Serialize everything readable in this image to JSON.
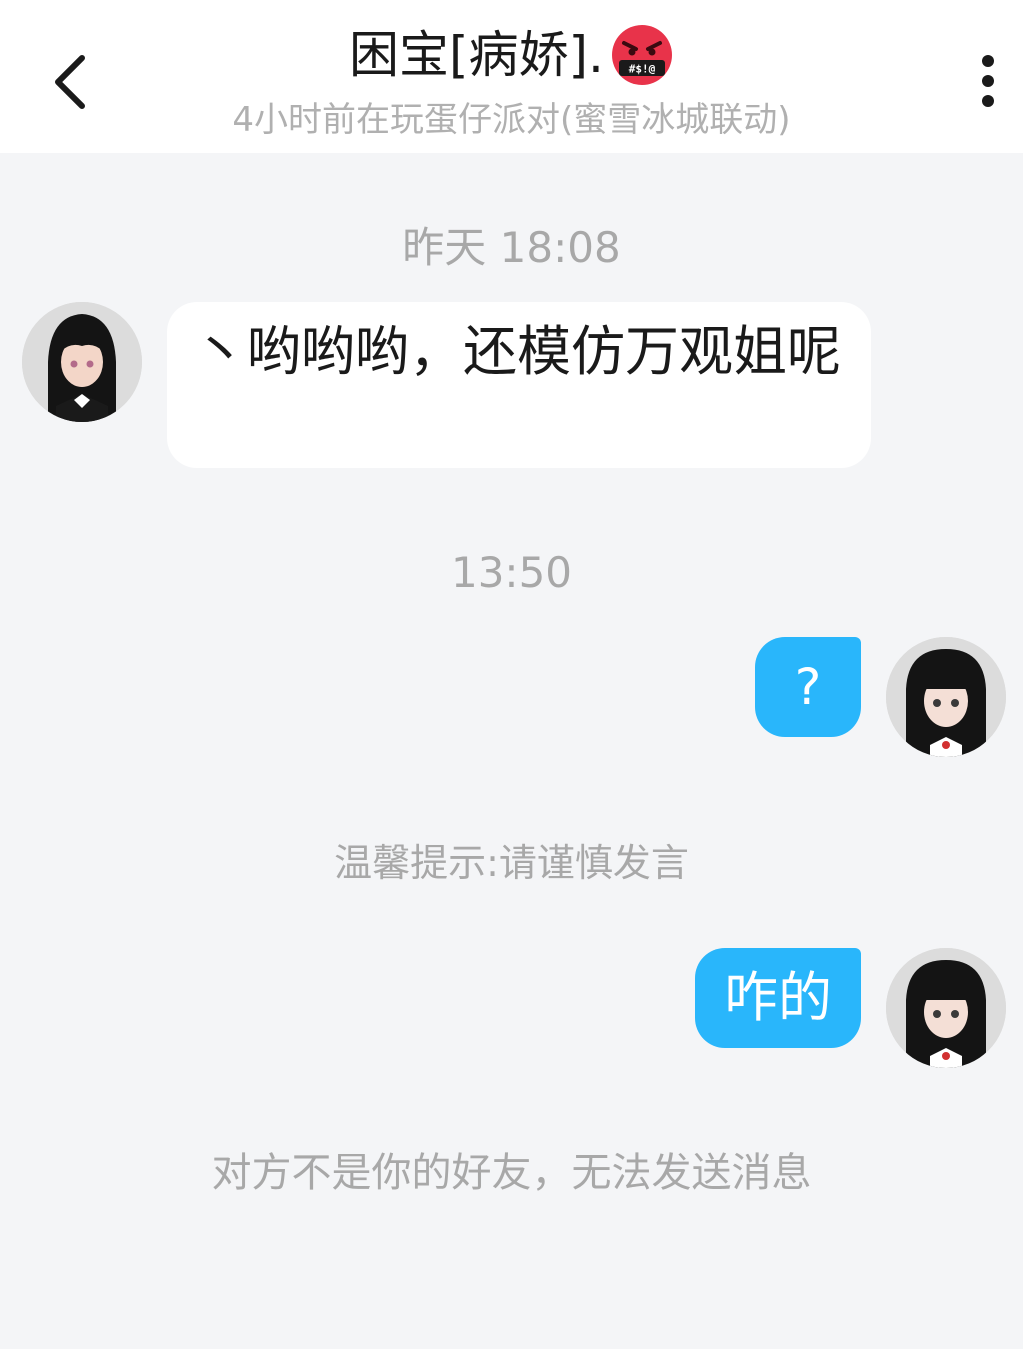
{
  "header": {
    "back_icon": "chevron-left-icon",
    "title": "困宝[病娇].",
    "title_emoji": "swearing-face-emoji",
    "title_emoji_text": "#$!@",
    "subtitle": "4小时前在玩蛋仔派对(蜜雪冰城联动)",
    "more_icon": "vertical-dots-icon"
  },
  "messages": {
    "timestamp_1": "昨天 18:08",
    "incoming_1": "丶哟哟哟，还模仿万观姐呢",
    "timestamp_2": "13:50",
    "outgoing_1": "?",
    "notice_1": "温馨提示:请谨慎发言",
    "outgoing_2": "咋的",
    "notice_2": "对方不是你的好友，无法发送消息"
  },
  "colors": {
    "outgoing_bubble": "#29b6fb",
    "incoming_bubble": "#ffffff",
    "background": "#f4f5f7",
    "emoji_red": "#e8334a"
  }
}
